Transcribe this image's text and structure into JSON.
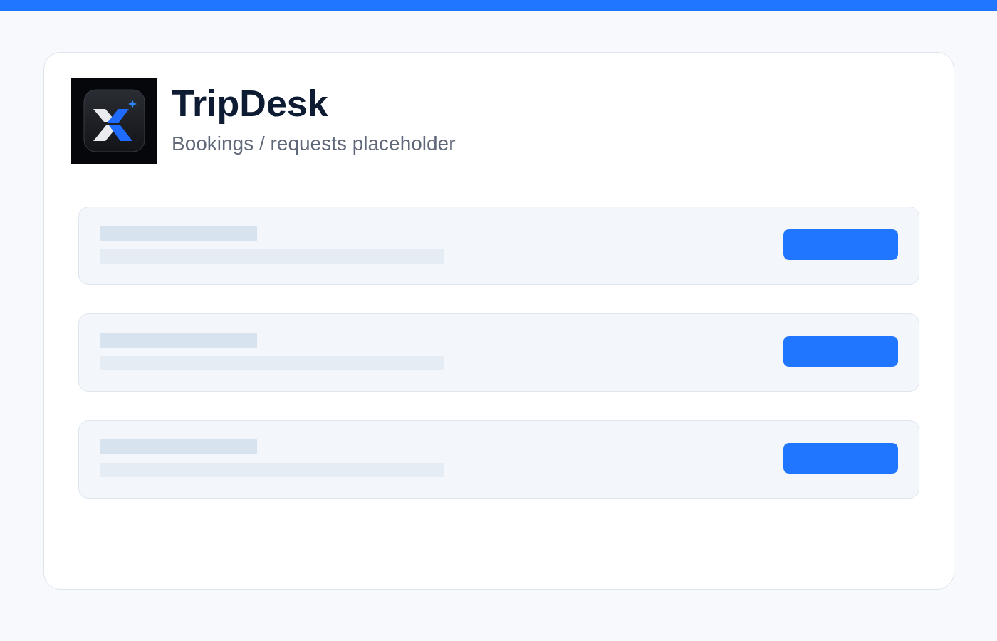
{
  "header": {
    "title": "TripDesk",
    "subtitle": "Bookings / requests placeholder"
  },
  "rows": [
    {
      "kind": "skeleton"
    },
    {
      "kind": "skeleton"
    },
    {
      "kind": "skeleton"
    }
  ]
}
